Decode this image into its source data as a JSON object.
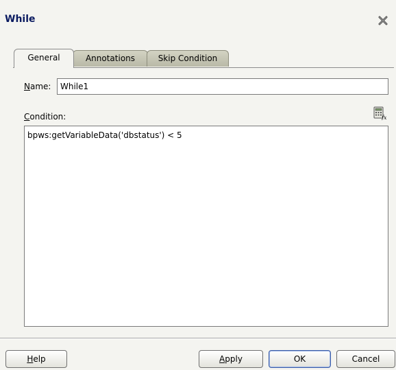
{
  "dialog": {
    "title": "While",
    "close_icon": "close-x-icon"
  },
  "tabs": [
    {
      "label": "General",
      "active": true
    },
    {
      "label": "Annotations",
      "active": false
    },
    {
      "label": "Skip Condition",
      "active": false
    }
  ],
  "form": {
    "name_label_mnemonic": "N",
    "name_label_rest": "ame:",
    "name_value": "While1",
    "condition_label_mnemonic": "C",
    "condition_label_rest": "ondition:",
    "condition_value": "bpws:getVariableData('dbstatus') < 5",
    "expression_builder_icon": "expression-builder-icon"
  },
  "buttons": {
    "help_mnemonic": "H",
    "help_rest": "elp",
    "apply_mnemonic": "A",
    "apply_rest": "pply",
    "ok": "OK",
    "cancel": "Cancel"
  },
  "colors": {
    "title": "#0a1a60",
    "background": "#f4f4f0",
    "inactive_tab": "#c9c9b8",
    "default_button_border": "#3c5ea8"
  }
}
